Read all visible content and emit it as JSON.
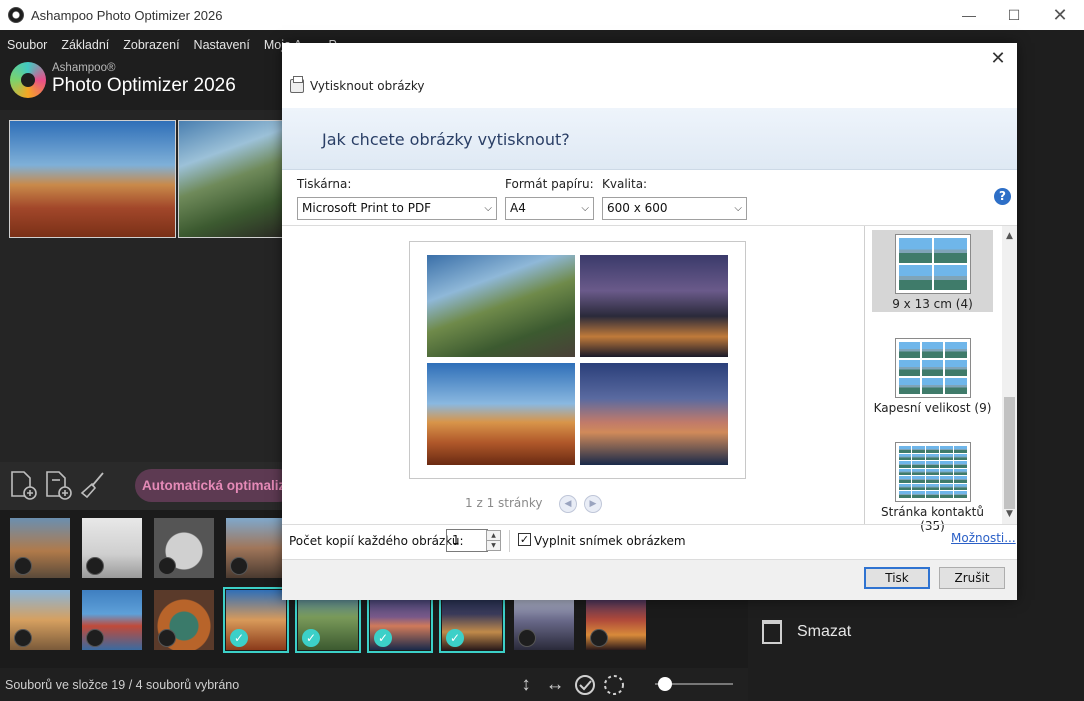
{
  "window": {
    "title": "Ashampoo Photo Optimizer 2026"
  },
  "menu": [
    "Soubor",
    "Základní",
    "Zobrazení",
    "Nastavení",
    "Moje A…",
    "P…"
  ],
  "logo": {
    "brand": "Ashampoo®",
    "product": "Photo Optimizer 2026"
  },
  "toolbar": {
    "auto_label": "Automatická optimaliz"
  },
  "status": {
    "text": "Souborů ve složce 19 / 4 souborů vybráno",
    "zoom_fraction": 0.1
  },
  "right_panel": {
    "delete_label": "Smazat"
  },
  "dialog": {
    "title": "Vytisknout obrázky",
    "question": "Jak chcete obrázky vytisknout?",
    "printer_label": "Tiskárna:",
    "printer_value": "Microsoft Print to PDF",
    "paper_label": "Formát papíru:",
    "paper_value": "A4",
    "quality_label": "Kvalita:",
    "quality_value": "600 x 600",
    "page_info": "1 z 1 stránky",
    "layouts": [
      {
        "label": "9 x 13 cm (4)",
        "selected": true
      },
      {
        "label": "Kapesní velikost (9)",
        "selected": false
      },
      {
        "label": "Stránka kontaktů (35)",
        "selected": false
      }
    ],
    "copies_label": "Počet kopií každého obrázku:",
    "copies_value": "1",
    "fill_label": "Vyplnit snímek obrázkem",
    "fill_checked": true,
    "options_link": "Možnosti...",
    "print_button": "Tisk",
    "cancel_button": "Zrušit"
  },
  "colors": {
    "accent": "#3cd0c8",
    "auto_button": "#5d3a52",
    "dialog_header": "#dfe9f4",
    "link": "#2b60c7"
  },
  "thumbnails": [
    {
      "name": "coast-cliffs",
      "selected": false
    },
    {
      "name": "foggy-bridge",
      "selected": false
    },
    {
      "name": "route-66-sign",
      "selected": false
    },
    {
      "name": "street-market",
      "selected": false
    },
    {
      "name": "cliff-village",
      "selected": false
    },
    {
      "name": "colorful-houses",
      "selected": false
    },
    {
      "name": "horseshoe-bend",
      "selected": false
    },
    {
      "name": "monument-valley",
      "selected": true
    },
    {
      "name": "old-truck",
      "selected": true
    },
    {
      "name": "bridge-sunset",
      "selected": true
    },
    {
      "name": "city-night",
      "selected": true
    },
    {
      "name": "lake-church",
      "selected": false
    },
    {
      "name": "festival-lights",
      "selected": false
    }
  ]
}
